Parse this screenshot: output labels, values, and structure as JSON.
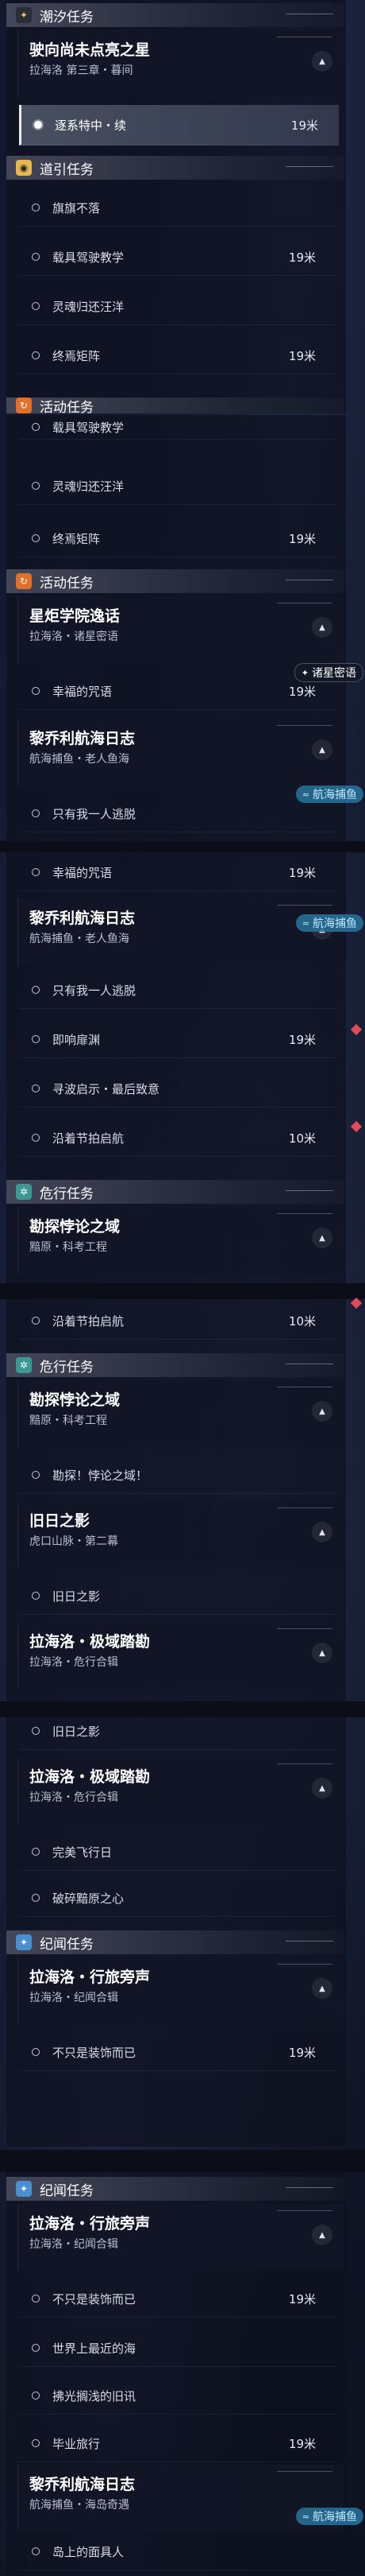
{
  "cat_tide": "潮汐任务",
  "cat_guide": "道引任务",
  "cat_activity": "活动任务",
  "cat_danger": "危行任务",
  "cat_chronicle": "纪闻任务",
  "q_star": {
    "title": "驶向尚未点亮之星",
    "sub": "拉海洛 第三章・暮间"
  },
  "q_star_sel": {
    "label": "逐系特中・续",
    "dist": "19米"
  },
  "guide_items": [
    "旗旗不落",
    "载具驾驶教学",
    "灵魂归还汪洋",
    "终焉矩阵"
  ],
  "guide_dist": "19米",
  "q_torch": {
    "title": "星炬学院逸话",
    "sub": "拉海洛・诸星密语",
    "tag": "诸星密语"
  },
  "q_torch_item": {
    "label": "幸福的咒语",
    "dist": "19米"
  },
  "q_jojo": {
    "title": "黎乔利航海日志",
    "sub": "航海捕鱼・老人鱼海",
    "tag": "航海捕鱼"
  },
  "jojo_items": [
    {
      "label": "只有我一人逃脱",
      "dist": ""
    },
    {
      "label": "即响扉渊",
      "dist": "19米"
    },
    {
      "label": "寻波启示・最后致意",
      "dist": ""
    },
    {
      "label": "沿着节拍启航",
      "dist": "10米"
    }
  ],
  "q_explore": {
    "title": "勘探悖论之域",
    "sub": "黯原・科考工程"
  },
  "explore_item": "勘探！悖论之域！",
  "q_old": {
    "title": "旧日之影",
    "sub": "虎口山脉・第二幕"
  },
  "old_item": "旧日之影",
  "q_limit": {
    "title": "拉海洛・极域踏勘",
    "sub": "拉海洛・危行合辑"
  },
  "limit_items": [
    "完美飞行日",
    "破碎黯原之心"
  ],
  "q_travel": {
    "title": "拉海洛・行旅旁声",
    "sub": "拉海洛・纪闻合辑"
  },
  "travel_items": [
    {
      "label": "不只是装饰而已",
      "dist": "19米"
    },
    {
      "label": "世界上最近的海",
      "dist": ""
    },
    {
      "label": "拂光搁浅的旧讯",
      "dist": ""
    },
    {
      "label": "毕业旅行",
      "dist": "19米"
    }
  ],
  "q_jojo2": {
    "title": "黎乔利航海日志",
    "sub": "航海捕鱼・海岛奇遇",
    "tag": "航海捕鱼"
  },
  "jojo2_item": "岛上的面具人"
}
